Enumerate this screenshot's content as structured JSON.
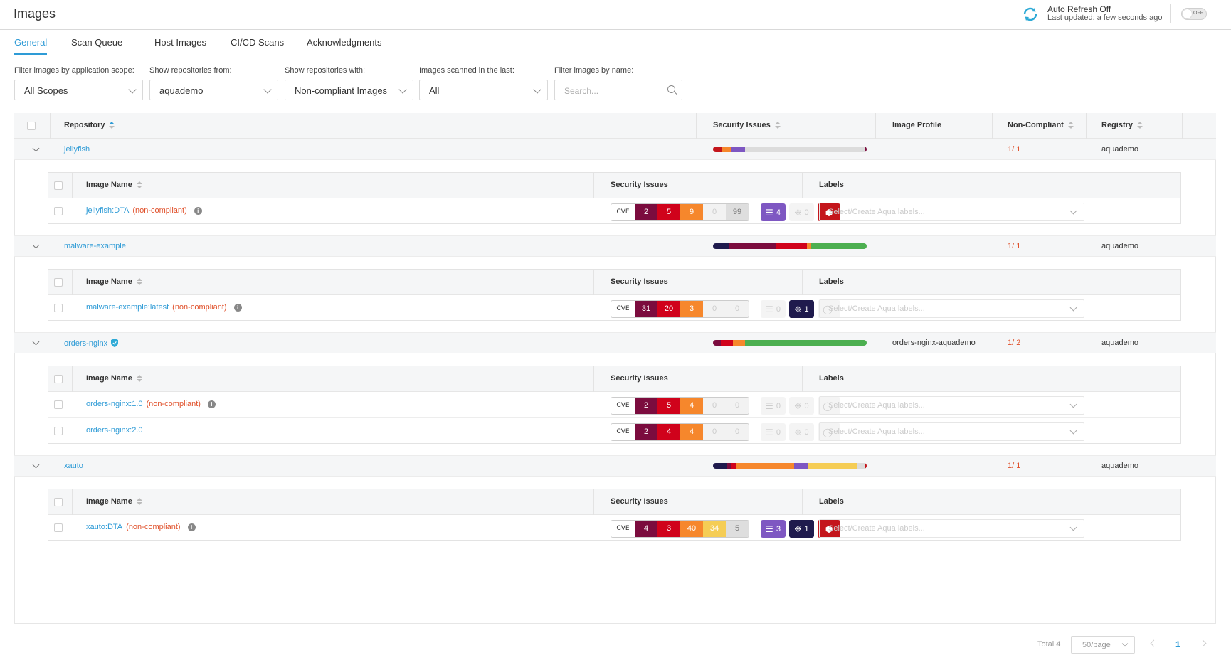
{
  "header": {
    "title": "Images",
    "auto_refresh_label": "Auto Refresh Off",
    "last_updated": "Last updated: a few seconds ago",
    "toggle_label": "OFF"
  },
  "tabs": [
    "General",
    "Scan Queue",
    "Host Images",
    "CI/CD Scans",
    "Acknowledgments"
  ],
  "filters": {
    "scope_label": "Filter images by application scope:",
    "scope_value": "All Scopes",
    "repos_from_label": "Show repositories from:",
    "repos_from_value": "aquademo",
    "repos_with_label": "Show repositories with:",
    "repos_with_value": "Non-compliant Images",
    "scanned_label": "Images scanned in the last:",
    "scanned_value": "All",
    "name_label": "Filter images by name:",
    "name_placeholder": "Search..."
  },
  "columns": {
    "repository": "Repository",
    "security_issues": "Security Issues",
    "image_profile": "Image Profile",
    "non_compliant": "Non-Compliant",
    "registry": "Registry"
  },
  "inner_columns": {
    "image_name": "Image Name",
    "security_issues": "Security Issues",
    "labels": "Labels"
  },
  "cve_label": "CVE",
  "labels_placeholder": "Select/Create Aqua labels...",
  "noncompliant_tag": "(non-compliant)",
  "repos": [
    {
      "name": "jellyfish",
      "profile": "",
      "non_compliant": "1/ 1",
      "registry": "aquademo",
      "bar": [
        {
          "color": "#c4161c",
          "frac": 0.06
        },
        {
          "color": "#f6872c",
          "frac": 0.06
        },
        {
          "color": "#7e57c2",
          "frac": 0.09
        },
        {
          "color": "#dcdcdc",
          "frac": 0.78
        },
        {
          "color": "#7b0c3e",
          "frac": 0.01
        }
      ],
      "images": [
        {
          "name": "jellyfish:DTA",
          "noncompliant": true,
          "critical": "2",
          "high": "5",
          "medium": "9",
          "low": "0",
          "negligible": "99",
          "malware": "4",
          "malware_on": true,
          "sensitive": "0",
          "sensitive_on": false,
          "extra_on": true
        }
      ]
    },
    {
      "name": "malware-example",
      "profile": "",
      "non_compliant": "1/ 1",
      "registry": "aquademo",
      "bar": [
        {
          "color": "#1f1a4d",
          "frac": 0.1
        },
        {
          "color": "#7b0c3e",
          "frac": 0.31
        },
        {
          "color": "#d0021b",
          "frac": 0.2
        },
        {
          "color": "#f6872c",
          "frac": 0.03
        },
        {
          "color": "#4caf50",
          "frac": 0.36
        }
      ],
      "images": [
        {
          "name": "malware-example:latest",
          "noncompliant": true,
          "critical": "31",
          "high": "20",
          "medium": "3",
          "low": "0",
          "negligible": "0",
          "malware": "0",
          "malware_on": false,
          "sensitive": "1",
          "sensitive_on": true,
          "extra_on": false
        }
      ]
    },
    {
      "name": "orders-nginx",
      "shield": true,
      "profile": "orders-nginx-aquademo",
      "non_compliant": "1/ 2",
      "registry": "aquademo",
      "bar": [
        {
          "color": "#7b0c3e",
          "frac": 0.05
        },
        {
          "color": "#d0021b",
          "frac": 0.08
        },
        {
          "color": "#f6872c",
          "frac": 0.08
        },
        {
          "color": "#4caf50",
          "frac": 0.79
        }
      ],
      "images": [
        {
          "name": "orders-nginx:1.0",
          "noncompliant": true,
          "critical": "2",
          "high": "5",
          "medium": "4",
          "low": "0",
          "negligible": "0",
          "malware": "0",
          "malware_on": false,
          "sensitive": "0",
          "sensitive_on": false,
          "extra_on": false
        },
        {
          "name": "orders-nginx:2.0",
          "noncompliant": false,
          "critical": "2",
          "high": "4",
          "medium": "4",
          "low": "0",
          "negligible": "0",
          "malware": "0",
          "malware_on": false,
          "sensitive": "0",
          "sensitive_on": false,
          "extra_on": false
        }
      ]
    },
    {
      "name": "xauto",
      "profile": "",
      "non_compliant": "1/ 1",
      "registry": "aquademo",
      "bar": [
        {
          "color": "#1f1a4d",
          "frac": 0.09
        },
        {
          "color": "#7b0c3e",
          "frac": 0.03
        },
        {
          "color": "#d0021b",
          "frac": 0.03
        },
        {
          "color": "#f6872c",
          "frac": 0.38
        },
        {
          "color": "#7e57c2",
          "frac": 0.09
        },
        {
          "color": "#f5cd55",
          "frac": 0.32
        },
        {
          "color": "#dcdcdc",
          "frac": 0.05
        },
        {
          "color": "#c4161c",
          "frac": 0.01
        }
      ],
      "images": [
        {
          "name": "xauto:DTA",
          "noncompliant": true,
          "critical": "4",
          "high": "3",
          "medium": "40",
          "low": "34",
          "negligible": "5",
          "malware": "3",
          "malware_on": true,
          "sensitive": "1",
          "sensitive_on": true,
          "extra_on": true
        }
      ]
    }
  ],
  "pagination": {
    "total": "Total 4",
    "page_size": "50/page",
    "current_page": "1"
  }
}
